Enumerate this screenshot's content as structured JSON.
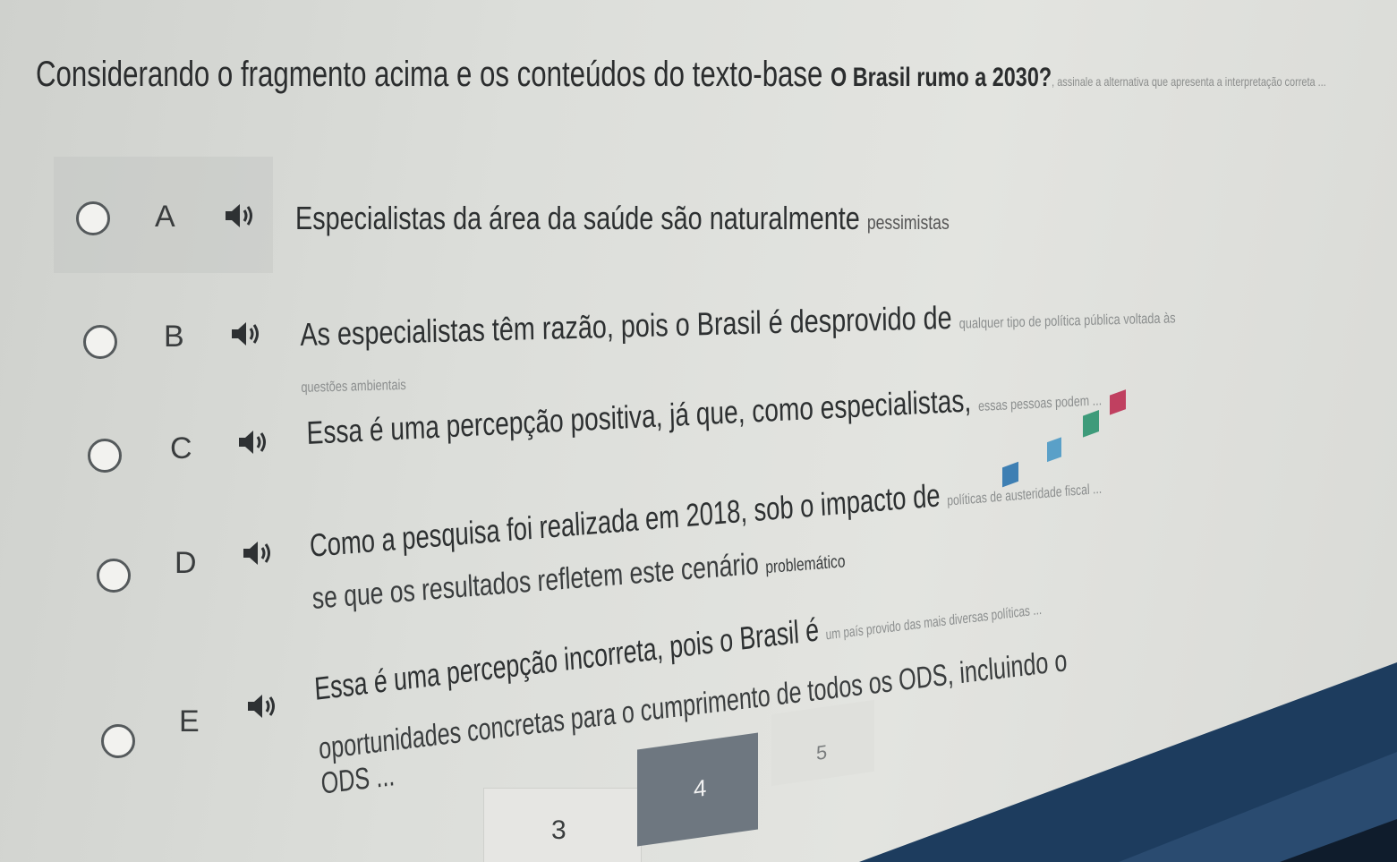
{
  "question": {
    "text_main": "Considerando o fragmento acima e os conteúdos do texto-base ",
    "text_bold": "O Brasil rumo a 2030?",
    "text_faded": ", assinale a alternativa que apresenta a interpretação correta ..."
  },
  "options": [
    {
      "letter": "A",
      "text": "Especialistas da área da saúde são naturalmente ",
      "text_tail": "pessimistas"
    },
    {
      "letter": "B",
      "text": "As especialistas têm razão, pois o Brasil é desprovido de ",
      "text_tail": "qualquer tipo de política pública voltada às questões ambientais"
    },
    {
      "letter": "C",
      "text": "Essa é uma percepção positiva, já que, como especialistas, ",
      "text_tail": "essas pessoas podem ..."
    },
    {
      "letter": "D",
      "text": "Como a pesquisa foi realizada em 2018, sob o impacto de ",
      "text_tail": "políticas de austeridade fiscal ...",
      "line2": "se que os resultados refletem este cenário ",
      "line2_tail": "problemático"
    },
    {
      "letter": "E",
      "text": "Essa é uma percepção incorreta, pois o Brasil é ",
      "text_tail": "um país provido das mais diversas políticas ...",
      "line2": "oportunidades concretas para o cumprimento de ",
      "line2_tail": "todos os ODS, incluindo o ODS ..."
    }
  ],
  "pagination": {
    "page_3": "3",
    "page_4": "4",
    "page_5": "5"
  },
  "colors": {
    "active_page": "#6e7780",
    "radio_border": "#555a5c"
  }
}
